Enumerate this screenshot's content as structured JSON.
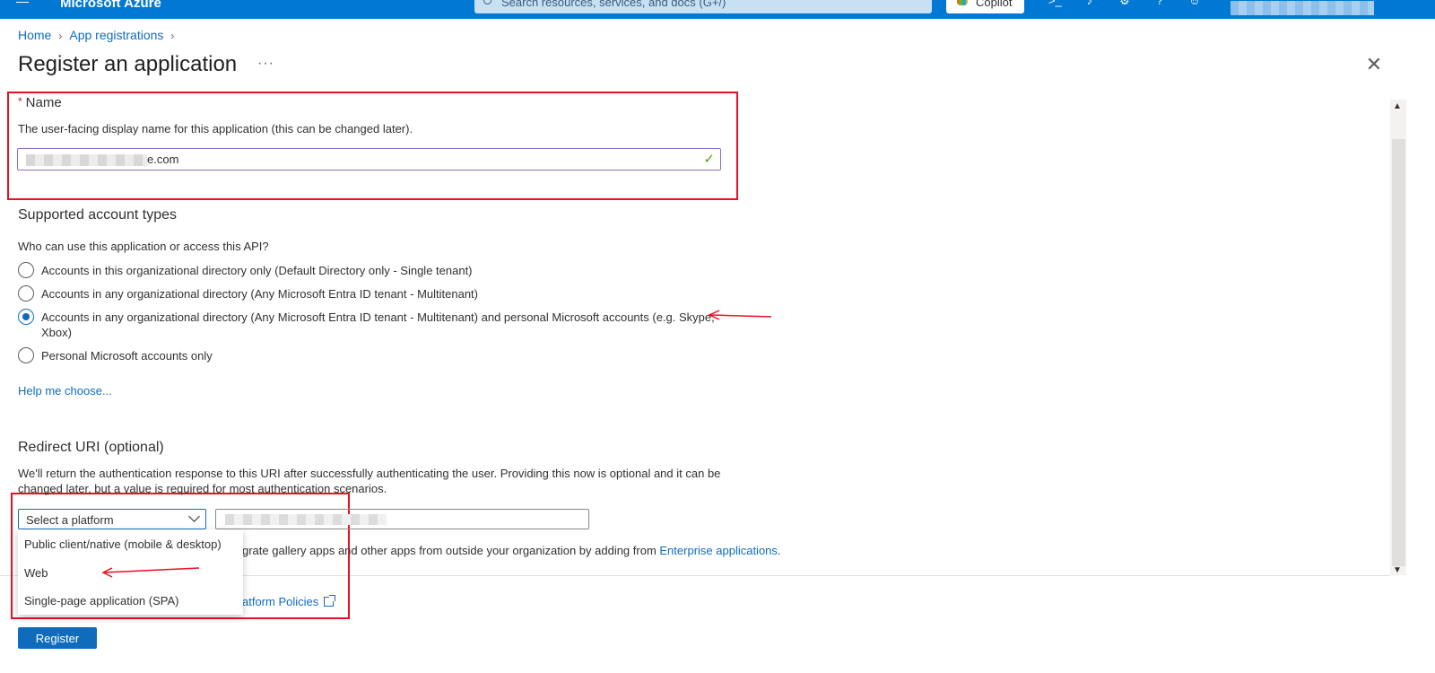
{
  "topbar": {
    "brand": "Microsoft Azure",
    "search_placeholder": "Search resources, services, and docs (G+/)",
    "copilot_label": "Copilot",
    "icons": [
      "cloud-shell-icon",
      "notifications-icon",
      "settings-icon",
      "help-icon",
      "feedback-icon"
    ]
  },
  "breadcrumb": {
    "home": "Home",
    "app_registrations": "App registrations"
  },
  "page": {
    "title": "Register an application",
    "more": "···",
    "close": "✕"
  },
  "name_section": {
    "label": "Name",
    "required_marker": "*",
    "description": "The user-facing display name for this application (this can be changed later).",
    "value_visible_suffix": "e.com"
  },
  "account_types": {
    "title": "Supported account types",
    "question": "Who can use this application or access this API?",
    "options": [
      {
        "label": "Accounts in this organizational directory only (Default Directory only - Single tenant)",
        "selected": false
      },
      {
        "label": "Accounts in any organizational directory (Any Microsoft Entra ID tenant - Multitenant)",
        "selected": false
      },
      {
        "label": "Accounts in any organizational directory (Any Microsoft Entra ID tenant - Multitenant) and personal Microsoft accounts (e.g. Skype, Xbox)",
        "selected": true
      },
      {
        "label": "Personal Microsoft accounts only",
        "selected": false
      }
    ],
    "help_link": "Help me choose..."
  },
  "redirect": {
    "title": "Redirect URI (optional)",
    "description": "We'll return the authentication response to this URI after successfully authenticating the user. Providing this now is optional and it can be changed later, but a value is required for most authentication scenarios.",
    "platform_placeholder": "Select a platform",
    "platform_options": [
      "Public client/native (mobile & desktop)",
      "Web",
      "Single-page application (SPA)"
    ]
  },
  "gallery": {
    "text": "grate gallery apps and other apps from outside your organization by adding from ",
    "link": "Enterprise applications",
    "suffix": "."
  },
  "policies_link": "atform Policies",
  "register_button": "Register",
  "colors": {
    "accent": "#0f6cbd",
    "topbar": "#0078d4",
    "annotation": "#e81123"
  }
}
